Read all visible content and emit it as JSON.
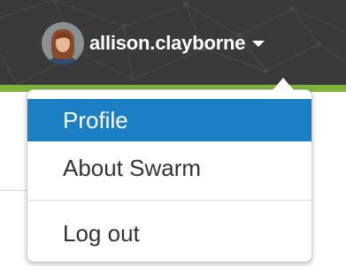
{
  "header": {
    "username": "allison.clayborne"
  },
  "menu": {
    "items": [
      {
        "label": "Profile",
        "active": true
      },
      {
        "label": "About Swarm",
        "active": false
      },
      {
        "label": "Log out",
        "active": false
      }
    ]
  },
  "colors": {
    "header_bg": "#3a3a3a",
    "accent_green": "#7fb33a",
    "active_item_bg": "#1a7fc4"
  },
  "icons": {
    "user_menu_caret": "caret-down-icon"
  }
}
